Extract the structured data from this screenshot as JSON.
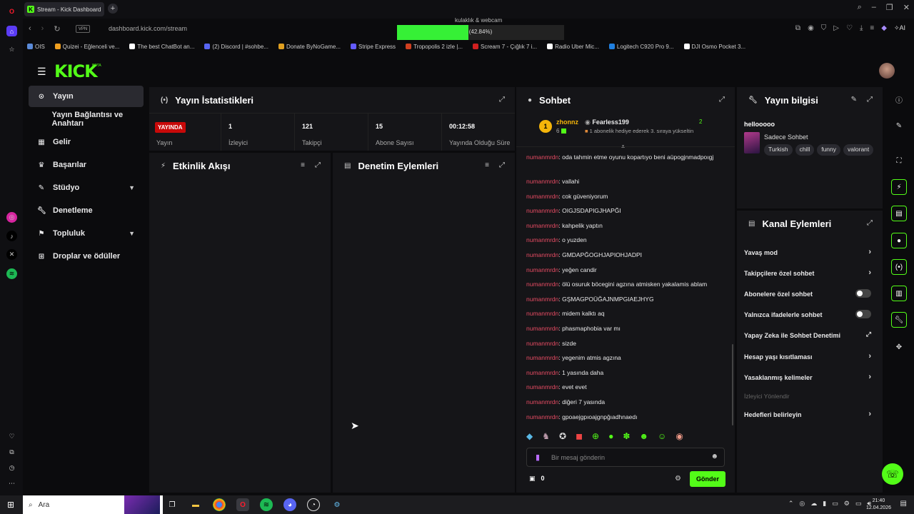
{
  "browser": {
    "tab_title": "Stream - Kick Dashboard",
    "url_domain": "dashboard.kick.com",
    "url_path": "/stream",
    "vpn_label": "VPN",
    "ai_label": "AI",
    "overlay_title": "kulaklık & webcam",
    "overlay_percent_text": "(42.84%)",
    "overlay_percent_value": 42.84,
    "bookmarks": [
      {
        "label": "OIS",
        "color": "#5a8ad8"
      },
      {
        "label": "Quizei - Eğlenceli ve...",
        "color": "#f0a020"
      },
      {
        "label": "The best ChatBot an...",
        "color": "#ffffff"
      },
      {
        "label": "(2) Discord | #sohbe...",
        "color": "#5865f2"
      },
      {
        "label": "Donate ByNoGame...",
        "color": "#e0a020"
      },
      {
        "label": "Stripe Express",
        "color": "#635bff"
      },
      {
        "label": "Tropopolis 2 izle |...",
        "color": "#d04020"
      },
      {
        "label": "Scream 7 - Çığlık 7 i...",
        "color": "#d02020"
      },
      {
        "label": "Radio Uber Mic...",
        "color": "#ffffff"
      },
      {
        "label": "Logitech C920 Pro 9...",
        "color": "#2080e0"
      },
      {
        "label": "DJI Osmo Pocket 3...",
        "color": "#ffffff"
      }
    ]
  },
  "nav": {
    "items": [
      {
        "label": "Yayın",
        "icon": "broadcast-icon"
      },
      {
        "label": "Yayın Bağlantısı ve Anahtarı",
        "icon": ""
      },
      {
        "label": "Gelir",
        "icon": "revenue-icon"
      },
      {
        "label": "Başarılar",
        "icon": "trophy-icon"
      },
      {
        "label": "Stüdyo",
        "icon": "studio-icon"
      },
      {
        "label": "Denetleme",
        "icon": "wrench-icon"
      },
      {
        "label": "Topluluk",
        "icon": "community-icon"
      },
      {
        "label": "Droplar ve ödüller",
        "icon": "gift-icon"
      }
    ]
  },
  "stats": {
    "title": "Yayın İstatistikleri",
    "live_badge": "YAYINDA",
    "live_label": "Yayın",
    "items": [
      {
        "value": "1",
        "label": "İzleyici"
      },
      {
        "value": "121",
        "label": "Takipçi"
      },
      {
        "value": "15",
        "label": "Abone Sayısı"
      },
      {
        "value": "00:12:58",
        "label": "Yayında Olduğu Süre"
      }
    ]
  },
  "activity": {
    "title": "Etkinlik Akışı"
  },
  "moderation": {
    "title": "Denetim Eylemleri"
  },
  "chat": {
    "title": "Sohbet",
    "pinned_rank": "1",
    "pinned_user": "zhonnz",
    "pinned_count": "6",
    "pinned_gifter": "Fearless199",
    "pinned_gifter_count": "2",
    "pinned_text": "1 abonelik hediye ederek 3. sıraya yükseltin",
    "username": "numanmrdn",
    "messages": [
      "oda tahmin etme oyunu kopartıyo beni aüpogjnmadpoıgj",
      "vallahi",
      "cok güveniyorum",
      "OIGJSDAPIGJHAPĞI",
      "kahpelik yaptın",
      "o yuzden",
      "GMDAPĞOGHJAPIOHJADPI",
      "yeğen candir",
      "ölü osuruk böcegini agzına atmisken yakalamis ablam",
      "GŞMAGPOÜĞAJNMPGIAEJHYG",
      "midem kalktı aq",
      "phasmaphobia var mı",
      "sizde",
      "yegenim atmis agzına",
      "1 yasında daha",
      "evet evet",
      "diğeri 7 yasında",
      "gpoaejgpıoajgnpğıadhnaedı"
    ],
    "input_placeholder": "Bir mesaj gönderin",
    "points": "0",
    "send_label": "Gönder"
  },
  "stream_info": {
    "title": "Yayın bilgisi",
    "stream_title": "hellooooo",
    "category": "Sadece Sohbet",
    "tags": [
      "Turkish",
      "chill",
      "funny",
      "valorant"
    ]
  },
  "channel_actions": {
    "title": "Kanal Eylemleri",
    "items": [
      {
        "label": "Yavaş mod",
        "control": "chevron"
      },
      {
        "label": "Takipçilere özel sohbet",
        "control": "chevron"
      },
      {
        "label": "Abonelere özel sohbet",
        "control": "toggle"
      },
      {
        "label": "Yalnızca ifadelerle sohbet",
        "control": "toggle"
      },
      {
        "label": "Yapay Zeka ile Sohbet Denetimi",
        "control": "external"
      },
      {
        "label": "Hesap yaşı kısıtlaması",
        "control": "chevron"
      },
      {
        "label": "Yasaklanmış kelimeler",
        "control": "chevron"
      }
    ],
    "section_label": "İzleyici Yönlendir",
    "section_item": "Hedefleri belirleyin"
  },
  "taskbar": {
    "search_label": "Ara",
    "time": "21:40",
    "date": "12.04.2026"
  }
}
